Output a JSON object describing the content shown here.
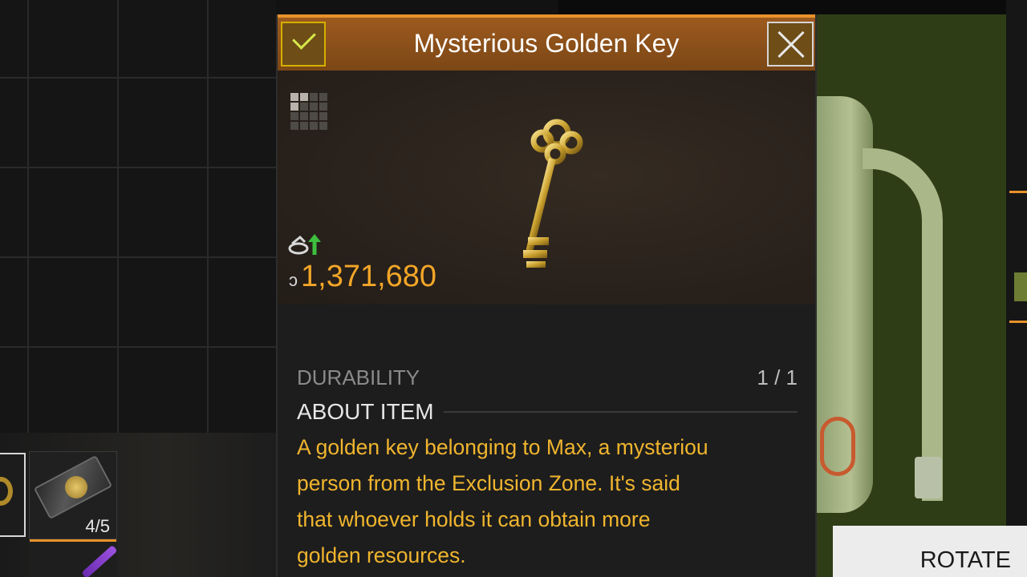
{
  "item": {
    "title": "Mysterious Golden Key",
    "icon": "golden-key",
    "value_prefix": "ↄ",
    "value": "1,371,680",
    "durability_label": "DURABILITY",
    "durability_value": "1 / 1",
    "about_label": "ABOUT ITEM",
    "description": "A golden key belonging to Max, a mysteriou\n person from the Exclusion Zone. It's said\nthat whoever holds it can obtain more\ngolden resources."
  },
  "inventory": {
    "card_count": "4/5"
  },
  "actions": {
    "rotate_label": "ROTATE"
  },
  "colors": {
    "accent_orange": "#e8922a",
    "header_brown": "#9d5a1e",
    "value_gold": "#f3a628",
    "description_gold": "#f0b52e"
  }
}
